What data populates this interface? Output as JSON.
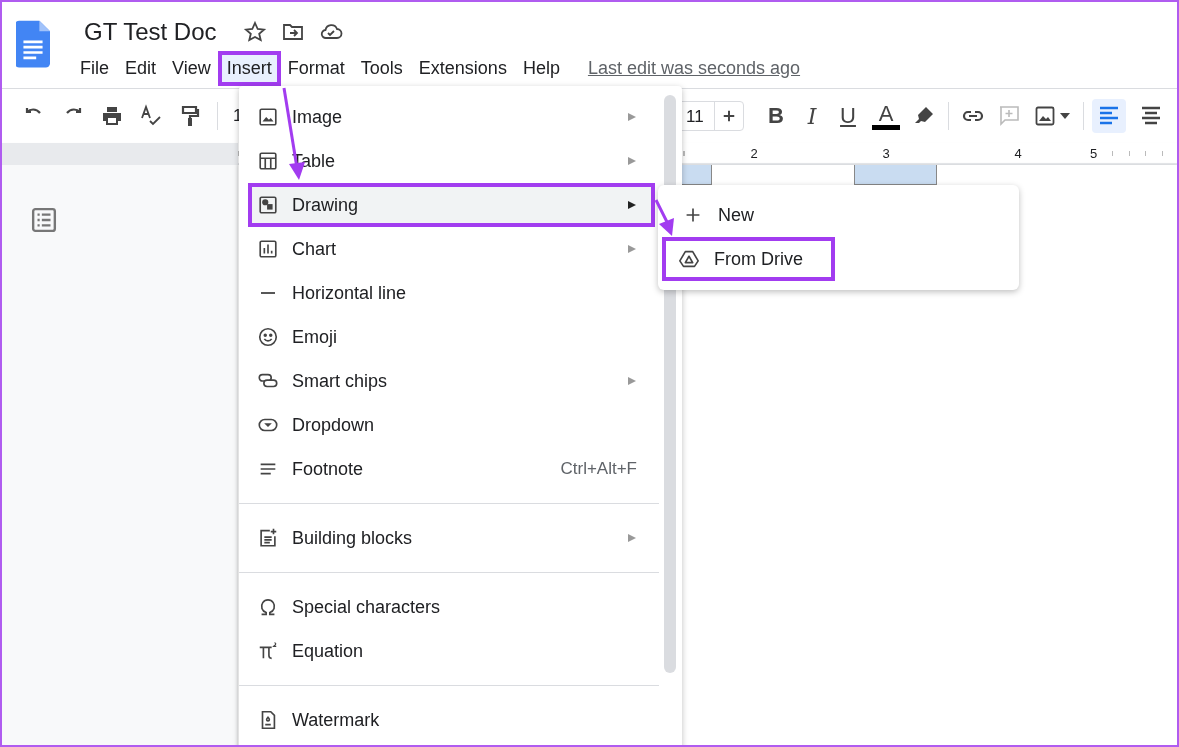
{
  "document": {
    "title": "GT Test Doc"
  },
  "menubar": {
    "items": [
      {
        "label": "File",
        "selected": false,
        "annotated": false
      },
      {
        "label": "Edit",
        "selected": false,
        "annotated": false
      },
      {
        "label": "View",
        "selected": false,
        "annotated": false
      },
      {
        "label": "Insert",
        "selected": true,
        "annotated": true
      },
      {
        "label": "Format",
        "selected": false,
        "annotated": false
      },
      {
        "label": "Tools",
        "selected": false,
        "annotated": false
      },
      {
        "label": "Extensions",
        "selected": false,
        "annotated": false
      },
      {
        "label": "Help",
        "selected": false,
        "annotated": false
      }
    ],
    "last_edit": "Last edit was seconds ago"
  },
  "toolbar": {
    "zoom_partial": "1",
    "font_size": "11",
    "bold": "B",
    "italic": "I",
    "underline": "U",
    "text_color": "A",
    "align": [
      {
        "selected": true
      },
      {
        "selected": false
      }
    ]
  },
  "ruler": {
    "numbers": [
      "2",
      "3",
      "4",
      "5"
    ]
  },
  "insert_menu": {
    "items": [
      {
        "kind": "item",
        "label": "Image",
        "has_submenu": true,
        "selected": false,
        "annotated": false
      },
      {
        "kind": "item",
        "label": "Table",
        "has_submenu": true,
        "selected": false,
        "annotated": false
      },
      {
        "kind": "item",
        "label": "Drawing",
        "has_submenu": true,
        "selected": true,
        "annotated": true
      },
      {
        "kind": "item",
        "label": "Chart",
        "has_submenu": true,
        "selected": false,
        "annotated": false
      },
      {
        "kind": "item",
        "label": "Horizontal line",
        "has_submenu": false,
        "selected": false,
        "annotated": false
      },
      {
        "kind": "item",
        "label": "Emoji",
        "has_submenu": false,
        "selected": false,
        "annotated": false
      },
      {
        "kind": "item",
        "label": "Smart chips",
        "has_submenu": true,
        "selected": false,
        "annotated": false
      },
      {
        "kind": "item",
        "label": "Dropdown",
        "has_submenu": false,
        "selected": false,
        "annotated": false
      },
      {
        "kind": "item",
        "label": "Footnote",
        "shortcut": "Ctrl+Alt+F",
        "has_submenu": false,
        "selected": false,
        "annotated": false
      },
      {
        "kind": "divider"
      },
      {
        "kind": "item",
        "label": "Building blocks",
        "has_submenu": true,
        "selected": false,
        "annotated": false
      },
      {
        "kind": "divider"
      },
      {
        "kind": "item",
        "label": "Special characters",
        "has_submenu": false,
        "selected": false,
        "annotated": false
      },
      {
        "kind": "item",
        "label": "Equation",
        "has_submenu": false,
        "selected": false,
        "annotated": false
      },
      {
        "kind": "divider"
      },
      {
        "kind": "item",
        "label": "Watermark",
        "has_submenu": false,
        "selected": false,
        "annotated": false
      }
    ]
  },
  "drawing_submenu": {
    "items": [
      {
        "label": "New",
        "annotated": false
      },
      {
        "label": "From Drive",
        "annotated": true
      }
    ]
  }
}
